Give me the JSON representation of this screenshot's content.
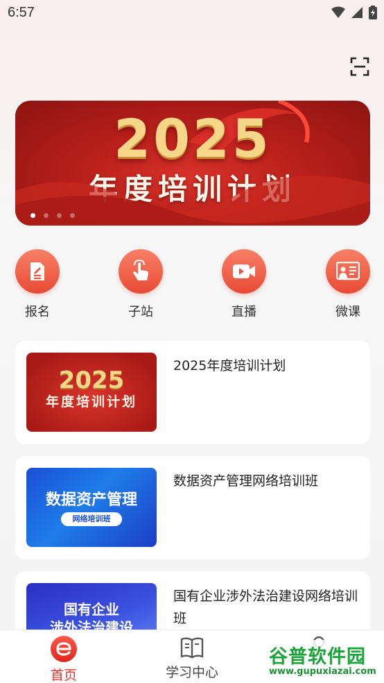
{
  "status_bar": {
    "time": "6:57",
    "icons": [
      "wifi-icon",
      "signal-icon",
      "battery-icon"
    ]
  },
  "header": {
    "scan_icon": "scan-icon"
  },
  "banner": {
    "year": "2025",
    "title": "年度培训计划",
    "page_count": 4,
    "active_index": 0
  },
  "quick_actions": [
    {
      "label": "报名",
      "icon": "form-edit-icon"
    },
    {
      "label": "子站",
      "icon": "tap-hand-icon"
    },
    {
      "label": "直播",
      "icon": "video-camera-icon"
    },
    {
      "label": "微课",
      "icon": "lecture-board-icon"
    }
  ],
  "courses": [
    {
      "title": "2025年度培训计划",
      "thumb_text": [
        "2025",
        "年度培训计划"
      ]
    },
    {
      "title": "数据资产管理网络培训班",
      "thumb_text": [
        "数据资产管理",
        "网络培训班"
      ]
    },
    {
      "title": "国有企业涉外法治建设网络培训班",
      "thumb_text": [
        "国有企业",
        "涉外法治建设"
      ]
    }
  ],
  "tabbar": {
    "tabs": [
      {
        "label": "首页",
        "icon": "home-logo-icon",
        "active": true
      },
      {
        "label": "学习中心",
        "icon": "book-icon",
        "active": false
      },
      {
        "label": "",
        "icon": "profile-icon",
        "active": false
      }
    ]
  },
  "watermark": {
    "title": "谷普软件园",
    "url": "www.gupuxiazai.com"
  },
  "colors": {
    "accent": "#e3322b",
    "banner_red": "#b81f1a",
    "gold": "#f6d78a"
  }
}
